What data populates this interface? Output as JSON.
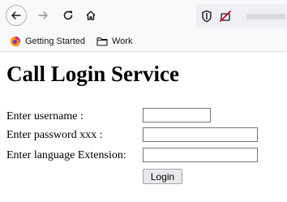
{
  "browser": {
    "toolbar": {
      "back_icon": "arrow-left-icon",
      "forward_icon": "arrow-right-icon",
      "reload_icon": "reload-icon",
      "home_icon": "home-icon",
      "shield_icon": "shield-icon",
      "blocked_icon": "permission-blocked-icon"
    },
    "bookmarks": [
      {
        "label": "Getting Started",
        "icon": "firefox-icon"
      },
      {
        "label": "Work",
        "icon": "folder-icon"
      }
    ]
  },
  "page": {
    "title": "Call Login Service",
    "form": {
      "username_label": "Enter username :",
      "username_value": "",
      "password_label": "Enter password xxx :",
      "password_value": "",
      "language_label": "Enter language Extension:",
      "language_value": "",
      "submit_label": "Login"
    }
  },
  "colors": {
    "toolbar_bg": "#f9f9fb",
    "icon_color": "#15141a",
    "blocked_red": "#d70022",
    "button_bg": "#e9e9ed"
  }
}
